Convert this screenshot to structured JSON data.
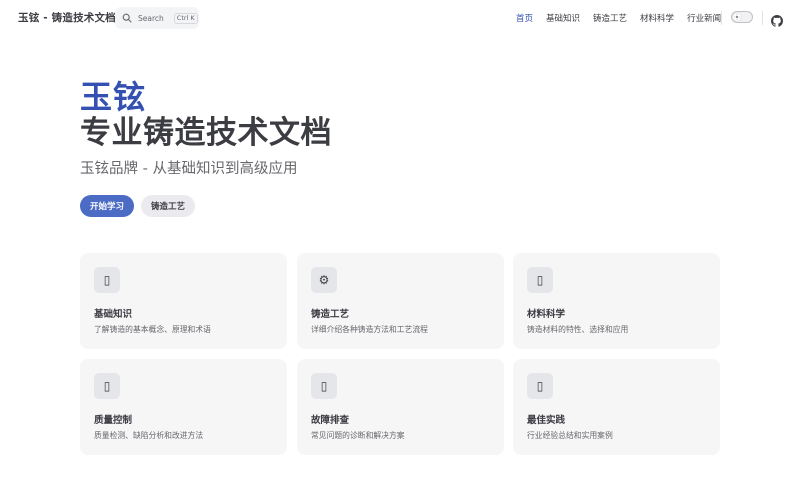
{
  "nav": {
    "site_title": "玉铉 - 铸造技术文档",
    "search_label": "Search",
    "search_kbd": "Ctrl K",
    "links": [
      {
        "label": "首页",
        "active": true
      },
      {
        "label": "基础知识",
        "active": false
      },
      {
        "label": "铸造工艺",
        "active": false
      },
      {
        "label": "材料科学",
        "active": false
      },
      {
        "label": "行业新闻",
        "active": false
      }
    ],
    "accent_color": "#3451b2"
  },
  "hero": {
    "name": "玉铉",
    "text": "专业铸造技术文档",
    "tagline": "玉铉品牌 - 从基础知识到高级应用",
    "actions": [
      {
        "label": "开始学习",
        "theme": "brand"
      },
      {
        "label": "铸造工艺",
        "theme": "alt"
      }
    ]
  },
  "features": [
    {
      "icon": "book-icon",
      "glyph": "▯",
      "title": "基础知识",
      "details": "了解铸造的基本概念、原理和术语"
    },
    {
      "icon": "gear-icon",
      "glyph": "⚙",
      "title": "铸造工艺",
      "details": "详细介绍各种铸造方法和工艺流程"
    },
    {
      "icon": "flask-icon",
      "glyph": "▯",
      "title": "材料科学",
      "details": "铸造材料的特性、选择和应用"
    },
    {
      "icon": "chart-icon",
      "glyph": "▯",
      "title": "质量控制",
      "details": "质量检测、缺陷分析和改进方法"
    },
    {
      "icon": "wrench-icon",
      "glyph": "▯",
      "title": "故障排查",
      "details": "常见问题的诊断和解决方案"
    },
    {
      "icon": "bulb-icon",
      "glyph": "▯",
      "title": "最佳实践",
      "details": "行业经验总结和实用案例"
    }
  ]
}
